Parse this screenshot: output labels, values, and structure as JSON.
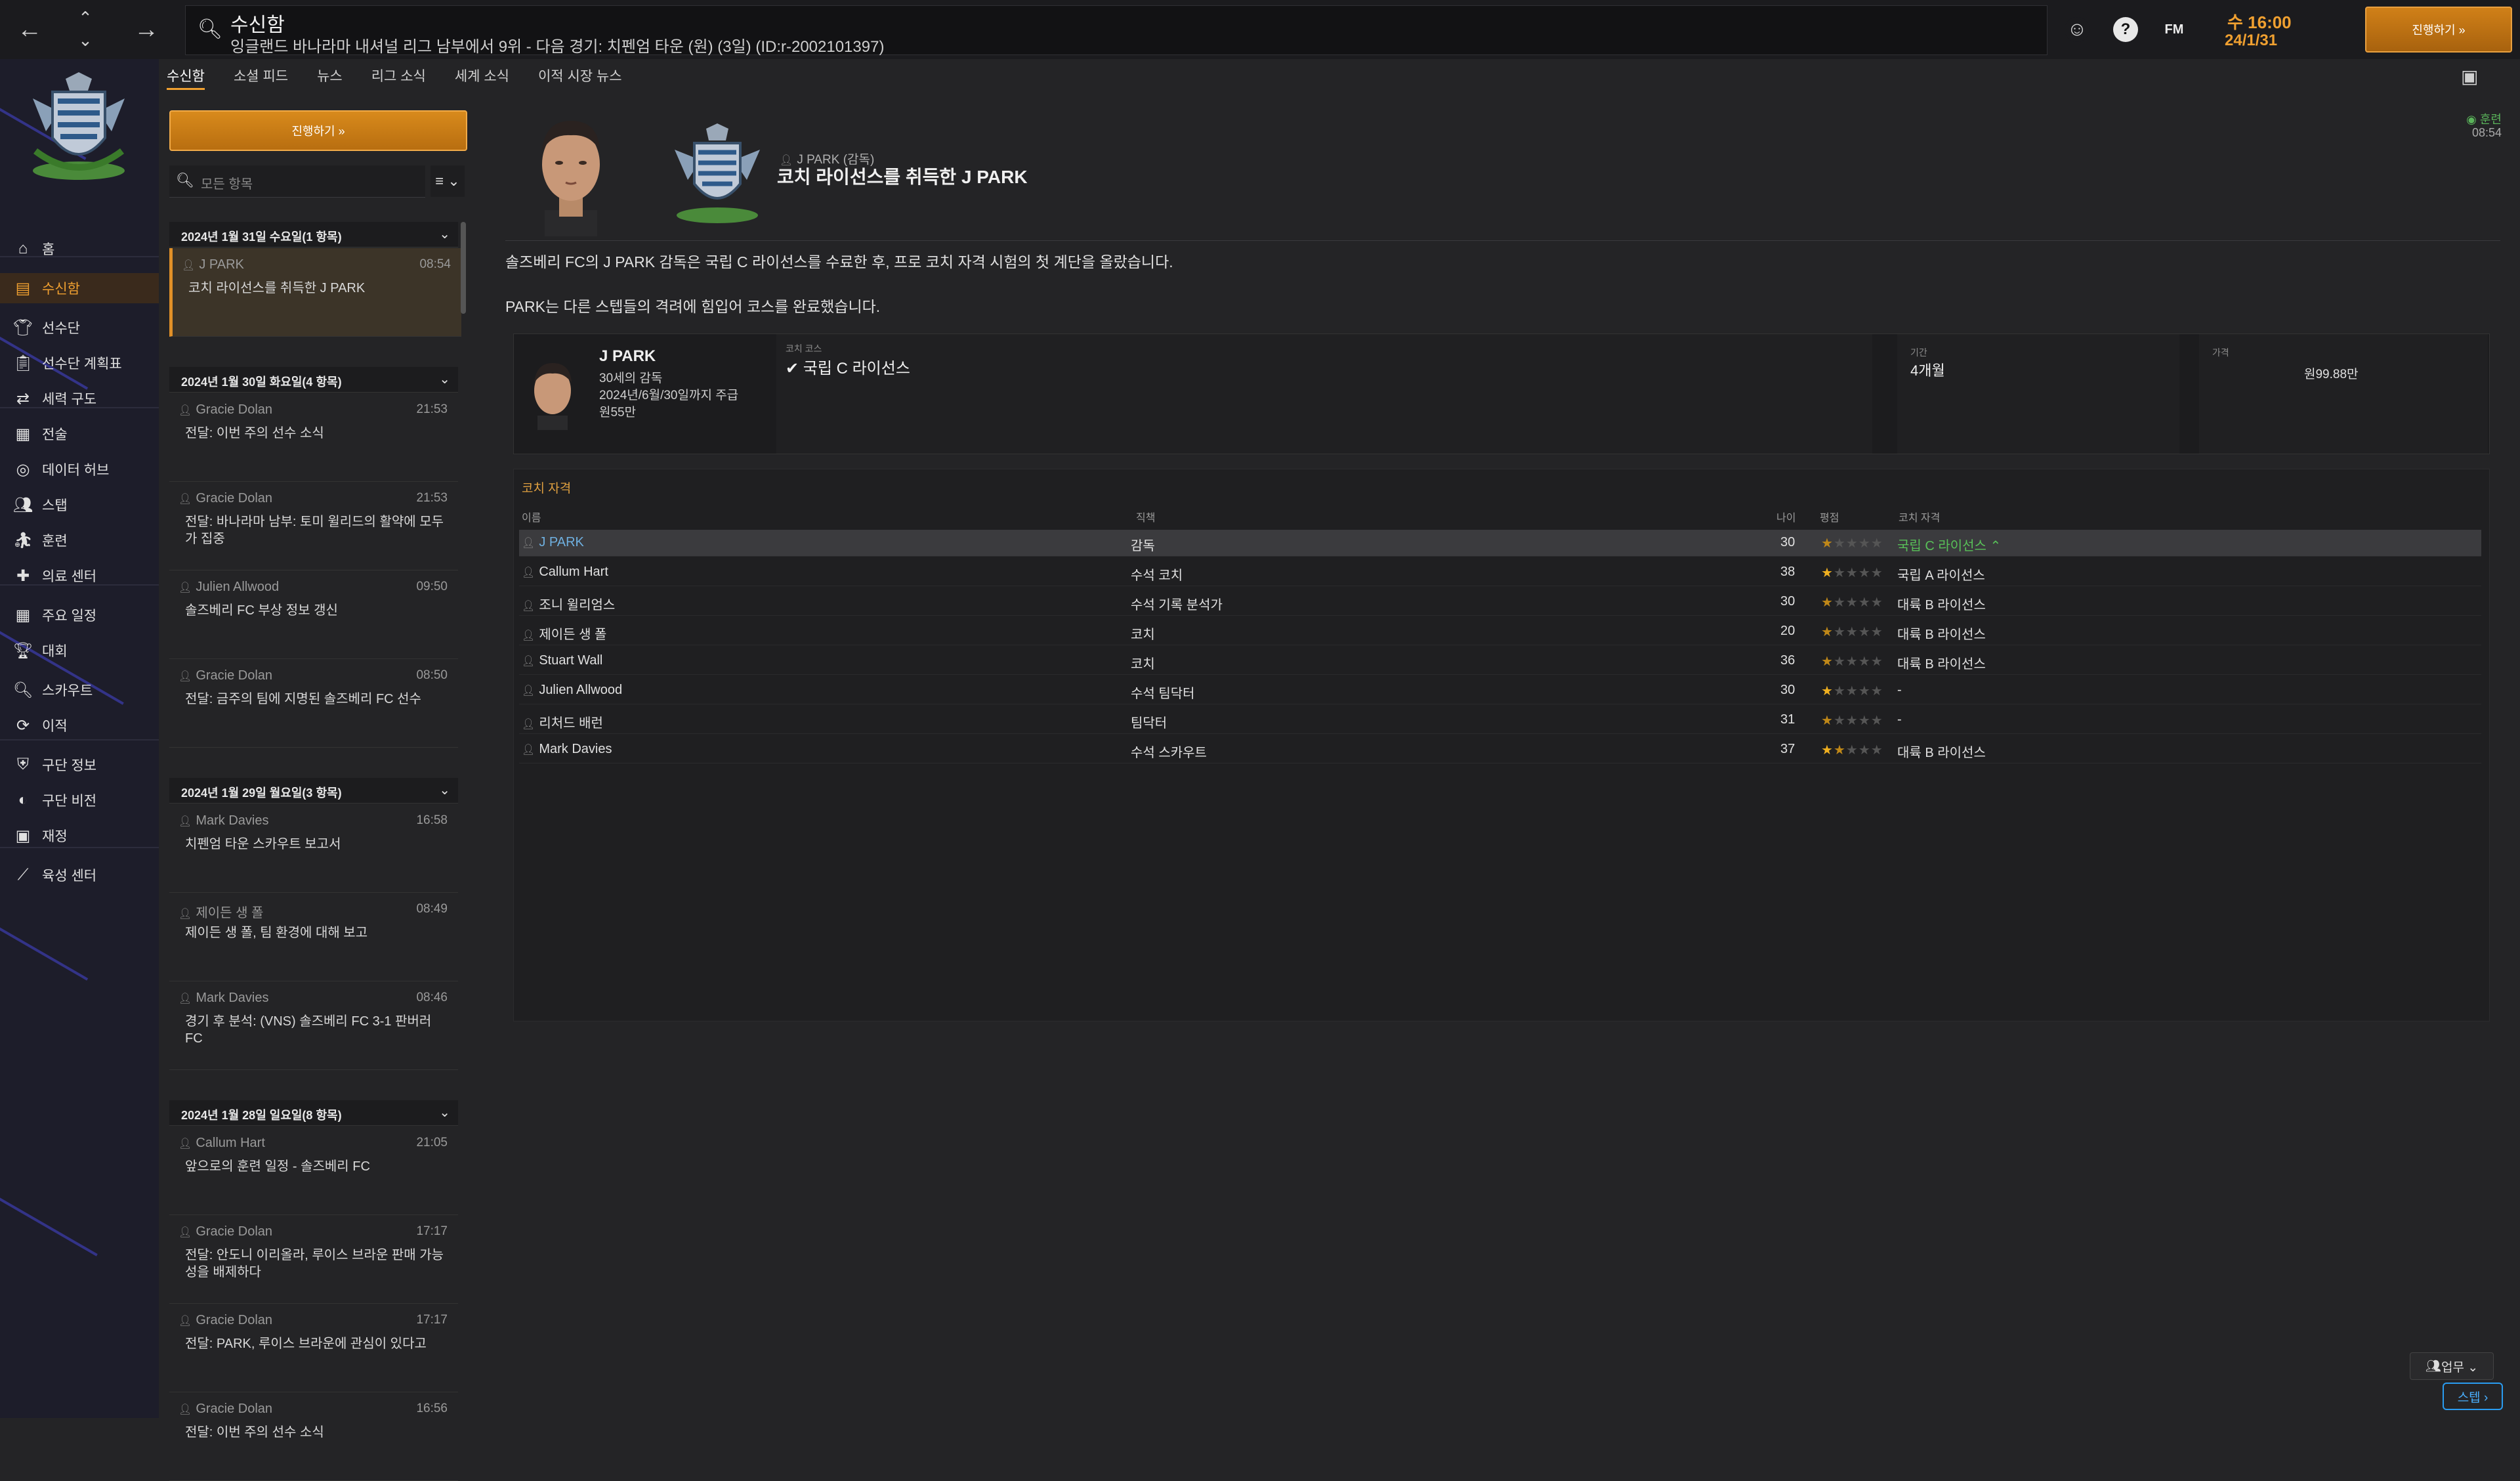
{
  "topbar": {
    "page_title": "수신함",
    "page_subtitle": "잉글랜드 바나라마 내셔널 리그 남부에서 9위 - 다음 경기: 치펜엄 타운 (원) (3일) (ID:r-2002101397)",
    "fm_label": "FM",
    "help_label": "?",
    "date_time": "수 16:00",
    "date_day": "24/1/31",
    "continue_label": "진행하기 »"
  },
  "tabs": [
    "수신함",
    "소셜 피드",
    "뉴스",
    "리그 소식",
    "세계 소식",
    "이적 시장 뉴스"
  ],
  "nav": {
    "items": [
      {
        "label": "홈",
        "icon": "home-icon"
      },
      {
        "label": "수신함",
        "icon": "inbox-icon"
      },
      {
        "label": "선수단",
        "icon": "shirt-icon"
      },
      {
        "label": "선수단 계획표",
        "icon": "clipboard-icon"
      },
      {
        "label": "세력 구도",
        "icon": "hierarchy-icon"
      },
      {
        "label": "전술",
        "icon": "tactics-board-icon"
      },
      {
        "label": "데이터 허브",
        "icon": "data-hub-icon"
      },
      {
        "label": "스탭",
        "icon": "staff-icon"
      },
      {
        "label": "훈련",
        "icon": "training-icon"
      },
      {
        "label": "의료 센터",
        "icon": "medical-icon"
      },
      {
        "label": "주요 일정",
        "icon": "calendar-icon"
      },
      {
        "label": "대회",
        "icon": "trophy-icon"
      },
      {
        "label": "스카우트",
        "icon": "scout-search-icon"
      },
      {
        "label": "이적",
        "icon": "transfer-icon"
      },
      {
        "label": "구단 정보",
        "icon": "shield-icon"
      },
      {
        "label": "구단 비전",
        "icon": "vision-icon"
      },
      {
        "label": "재정",
        "icon": "finance-icon"
      },
      {
        "label": "육성 센터",
        "icon": "development-icon"
      }
    ]
  },
  "inbox": {
    "continue_label": "진행하기 »",
    "search_placeholder": "모든 항목",
    "filter_label": "≡ ⌄",
    "groups": [
      {
        "title": "2024년 1월 31일 수요일(1 항목)",
        "messages": [
          {
            "person": "J PARK",
            "time": "08:54",
            "subject": "코치 라이선스를 취득한 J PARK",
            "selected": true
          }
        ]
      },
      {
        "title": "2024년 1월 30일 화요일(4 항목)",
        "messages": [
          {
            "person": "Gracie Dolan",
            "time": "21:53",
            "subject": "전달: 이번 주의 선수 소식"
          },
          {
            "person": "Gracie Dolan",
            "time": "21:53",
            "subject": "전달: 바나라마 남부: 토미 윌리드의 활약에 모두가 집중"
          },
          {
            "person": "Julien Allwood",
            "time": "09:50",
            "subject": "솔즈베리 FC 부상 정보 갱신"
          },
          {
            "person": "Gracie Dolan",
            "time": "08:50",
            "subject": "전달: 금주의 팀에 지명된 솔즈베리 FC 선수"
          }
        ]
      },
      {
        "title": "2024년 1월 29일 월요일(3 항목)",
        "messages": [
          {
            "person": "Mark Davies",
            "time": "16:58",
            "subject": "치펜엄 타운 스카우트 보고서"
          },
          {
            "person": "제이든 생 폴",
            "time": "08:49",
            "subject": "제이든 생 폴, 팀 환경에 대해 보고"
          },
          {
            "person": "Mark Davies",
            "time": "08:46",
            "subject": "경기 후 분석: (VNS) 솔즈베리 FC 3-1 판버러 FC"
          }
        ]
      },
      {
        "title": "2024년 1월 28일 일요일(8 항목)",
        "messages": [
          {
            "person": "Callum Hart",
            "time": "21:05",
            "subject": "앞으로의 훈련 일정 - 솔즈베리 FC"
          },
          {
            "person": "Gracie Dolan",
            "time": "17:17",
            "subject": "전달: 안도니 이리올라, 루이스 브라운 판매 가능성을 배제하다"
          },
          {
            "person": "Gracie Dolan",
            "time": "17:17",
            "subject": "전달: PARK, 루이스 브라운에 관심이 있다고"
          },
          {
            "person": "Gracie Dolan",
            "time": "16:56",
            "subject": "전달: 이번 주의 선수 소식"
          }
        ]
      }
    ]
  },
  "message": {
    "sender": "J PARK (감독)",
    "headline": "코치 라이선스를 취득한 J PARK",
    "unread_label": "훈련",
    "time": "08:54",
    "paragraph1": "솔즈베리 FC의 J PARK 감독은 국립 C 라이선스를 수료한 후, 프로 코치 자격 시험의 첫 계단을 올랐습니다.",
    "paragraph2": "PARK는 다른 스텝들의 격려에 힘입어 코스를 완료했습니다.",
    "card": {
      "name": "J PARK",
      "line1": "30세의 감독",
      "line2": "2024년/6월/30일까지 주급",
      "line3": "원55만",
      "course_label": "코치 코스",
      "course_value": "✔ 국립 C 라이선스",
      "duration_label": "기간",
      "duration_value": "4개월",
      "cost_label": "가격",
      "cost_value": "원99.88만"
    }
  },
  "qualifications": {
    "title": "코치 자격",
    "headers": {
      "name": "이름",
      "role": "직책",
      "age": "나이",
      "rating": "평점",
      "qual": "코치 자격"
    },
    "rows": [
      {
        "name": "J PARK",
        "role": "감독",
        "age": "30",
        "stars": 0.5,
        "qual": "국립 C 라이선스 ⌃",
        "me": true
      },
      {
        "name": "Callum Hart",
        "role": "수석 코치",
        "age": "38",
        "stars": 1,
        "qual": "국립 A 라이선스"
      },
      {
        "name": "조니 윌리엄스",
        "role": "수석 기록 분석가",
        "age": "30",
        "stars": 0.5,
        "qual": "대륙 B 라이선스"
      },
      {
        "name": "제이든 생 폴",
        "role": "코치",
        "age": "20",
        "stars": 0.5,
        "qual": "대륙 B 라이선스"
      },
      {
        "name": "Stuart Wall",
        "role": "코치",
        "age": "36",
        "stars": 0.5,
        "qual": "대륙 B 라이선스"
      },
      {
        "name": "Julien Allwood",
        "role": "수석 팀닥터",
        "age": "30",
        "stars": 1,
        "qual": "-"
      },
      {
        "name": "리처드 배런",
        "role": "팀닥터",
        "age": "31",
        "stars": 0.5,
        "qual": "-"
      },
      {
        "name": "Mark Davies",
        "role": "수석 스카우트",
        "age": "37",
        "stars": 1.5,
        "qual": "대륙 B 라이선스"
      }
    ]
  },
  "bottom": {
    "staff_label": "업무 ⌄",
    "next_label": "스텝 ›"
  }
}
